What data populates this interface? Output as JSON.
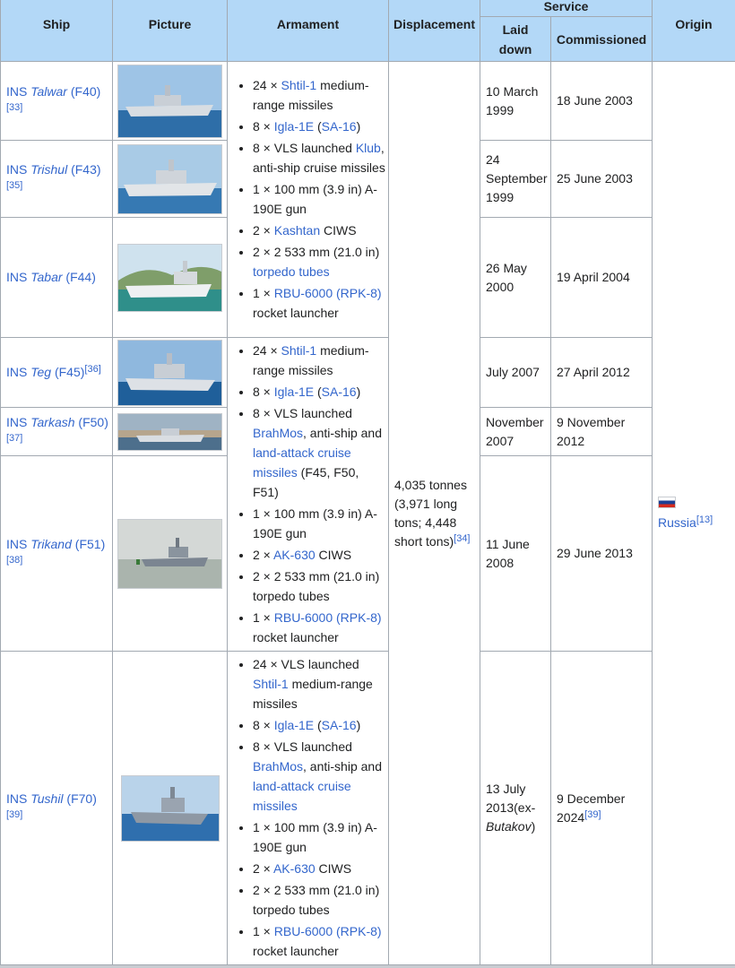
{
  "table": {
    "headers": {
      "ship": "Ship",
      "picture": "Picture",
      "armament": "Armament",
      "displacement": "Displacement",
      "service": "Service",
      "laid_down": "Laid down",
      "commissioned": "Commissioned",
      "origin": "Origin"
    },
    "rows": [
      {
        "prefix": "INS ",
        "name": "Talwar",
        "pennant": " (F40) ",
        "ref": "[33]",
        "laid_down": "10 March 1999",
        "commissioned": "18 June 2003",
        "picture": "ship-photo-talwar"
      },
      {
        "prefix": "INS ",
        "name": "Trishul",
        "pennant": " (F43) ",
        "ref": "[35]",
        "laid_down": "24 September 1999",
        "commissioned": "25 June 2003",
        "picture": "ship-photo-trishul"
      },
      {
        "prefix": "INS ",
        "name": "Tabar",
        "pennant": " (F44)",
        "ref": "",
        "laid_down": "26 May 2000",
        "commissioned": "19 April 2004",
        "picture": "ship-photo-tabar"
      },
      {
        "prefix": "INS ",
        "name": "Teg",
        "pennant": " (F45)",
        "ref": "[36]",
        "laid_down": "July 2007",
        "commissioned": "27 April 2012",
        "picture": "ship-photo-teg"
      },
      {
        "prefix": "INS ",
        "name": "Tarkash",
        "pennant": " (F50) ",
        "ref": "[37]",
        "laid_down": "November 2007",
        "commissioned": "9 November 2012",
        "picture": "ship-photo-tarkash"
      },
      {
        "prefix": "INS ",
        "name": "Trikand",
        "pennant": " (F51) ",
        "ref": "[38]",
        "laid_down": "11 June 2008",
        "commissioned": "29 June 2013",
        "picture": "ship-photo-trikand"
      },
      {
        "prefix": "INS ",
        "name": "Tushil",
        "pennant": " (F70) ",
        "ref": "[39]",
        "laid_down_a": "13 July 2013(ex-",
        "laid_down_b": "Butakov",
        "laid_down_c": ")",
        "commissioned": "9 December 2024",
        "commissioned_ref": "[39]",
        "picture": "ship-photo-tushil"
      }
    ],
    "armament_1": [
      {
        "a": "24 × ",
        "b": "Shtil-1",
        "c": " medium-range missiles"
      },
      {
        "a": "8 × ",
        "b": "Igla-1E",
        "c": " (",
        "d": "SA-16",
        "e": ")"
      },
      {
        "a": "8 × VLS launched ",
        "b": "Klub",
        "c": ", anti-ship cruise missiles"
      },
      {
        "a": "1 × 100 mm (3.9 in) A-190E gun"
      },
      {
        "a": "2 × ",
        "b": "Kashtan",
        "c": " CIWS"
      },
      {
        "a": "2 × 2 533 mm (21.0 in) ",
        "b": "torpedo tubes"
      },
      {
        "a": "1 × ",
        "b": "RBU-6000 (RPK-8)",
        "c": " rocket launcher"
      }
    ],
    "armament_2": [
      {
        "a": "24 × ",
        "b": "Shtil-1",
        "c": " medium-range missiles"
      },
      {
        "a": "8 × ",
        "b": "Igla-1E",
        "c": " (",
        "d": "SA-16",
        "e": ")"
      },
      {
        "a": "8 × VLS launched ",
        "b": "BrahMos",
        "c": ", anti-ship and ",
        "d": "land-attack cruise missiles",
        "e": " (F45, F50, F51)"
      },
      {
        "a": "1 × 100 mm (3.9 in) A-190E gun"
      },
      {
        "a": "2 × ",
        "b": "AK-630",
        "c": " CIWS"
      },
      {
        "a": "2 × 2 533 mm (21.0 in) torpedo tubes"
      },
      {
        "a": "1 × ",
        "b": "RBU-6000 (RPK-8)",
        "c": " rocket launcher"
      }
    ],
    "armament_3": [
      {
        "a": "24 × VLS launched ",
        "b": "Shtil-1",
        "c": " medium-range missiles"
      },
      {
        "a": "8 × ",
        "b": "Igla-1E",
        "c": " (",
        "d": "SA-16",
        "e": ")"
      },
      {
        "a": "8 × VLS launched ",
        "b": "BrahMos",
        "c": ", anti-ship and ",
        "d": "land-attack cruise missiles"
      },
      {
        "a": "1 × 100 mm (3.9 in) A-190E gun"
      },
      {
        "a": "2 × ",
        "b": "AK-630",
        "c": " CIWS"
      },
      {
        "a": "2 × 2 533 mm (21.0 in) torpedo tubes"
      },
      {
        "a": "1 × ",
        "b": "RBU-6000 (RPK-8)",
        "c": " rocket launcher"
      }
    ],
    "displacement": {
      "text": "4,035 tonnes (3,971 long tons; 4,448 short tons)",
      "ref": "[34]"
    },
    "origin": {
      "flag": "russia-flag-icon",
      "country": "Russia",
      "ref": "[13]"
    }
  },
  "colors": {
    "header_bg": "#b3d8f7",
    "link": "#3366cc",
    "border": "#a2a9b1",
    "text": "#202122"
  }
}
